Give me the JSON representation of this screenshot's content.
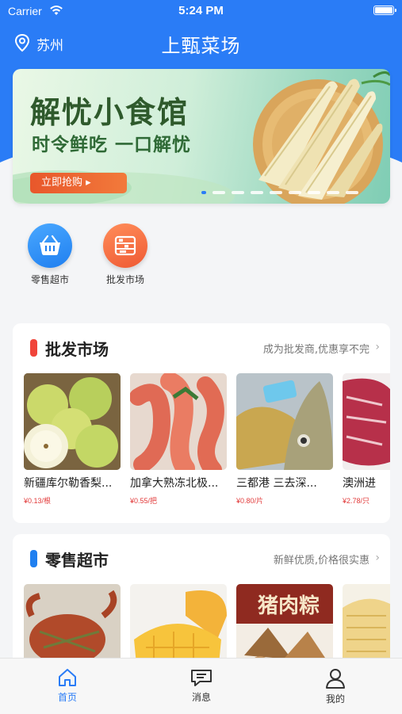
{
  "status_bar": {
    "carrier": "Carrier",
    "time": "5:24 PM"
  },
  "header": {
    "location": "苏州",
    "title": "上甄菜场"
  },
  "banner": {
    "headline": "解忧小食馆",
    "subhead": "时令鲜吃 一口解忧",
    "button_label": "立即抢购 ▸",
    "page_dots": 9,
    "active_dot": 0
  },
  "quick_entries": [
    {
      "label": "零售超市",
      "icon": "basket-icon",
      "color": "#1f7ff0"
    },
    {
      "label": "批发市场",
      "icon": "shelf-icon",
      "color": "#f36a3e"
    }
  ],
  "sections": [
    {
      "title": "批发市场",
      "subtitle": "成为批发商,优惠享不完",
      "accent": "#f0443a",
      "products": [
        {
          "name": "新疆库尔勒香梨...",
          "price": "¥0.13/根"
        },
        {
          "name": "加拿大熟冻北极...",
          "price": "¥0.55/把"
        },
        {
          "name": "三都港 三去深...",
          "price": "¥0.80/片"
        },
        {
          "name": "澳洲进",
          "price": "¥2.78/只"
        }
      ]
    },
    {
      "title": "零售超市",
      "subtitle": "新鲜优质,价格很实惠",
      "accent": "#1f7ff0",
      "products": [
        {
          "name": "",
          "price": ""
        },
        {
          "name": "",
          "price": ""
        },
        {
          "name": "",
          "price": "",
          "label": "猪肉粽"
        },
        {
          "name": "",
          "price": ""
        }
      ]
    }
  ],
  "tabbar": [
    {
      "label": "首页",
      "icon": "home-icon",
      "active": true
    },
    {
      "label": "消息",
      "icon": "message-icon",
      "active": false
    },
    {
      "label": "我的",
      "icon": "profile-icon",
      "active": false
    }
  ],
  "colors": {
    "brand": "#2a7cf6",
    "active_tab": "#2a7cf6",
    "price": "#e23b3b"
  }
}
